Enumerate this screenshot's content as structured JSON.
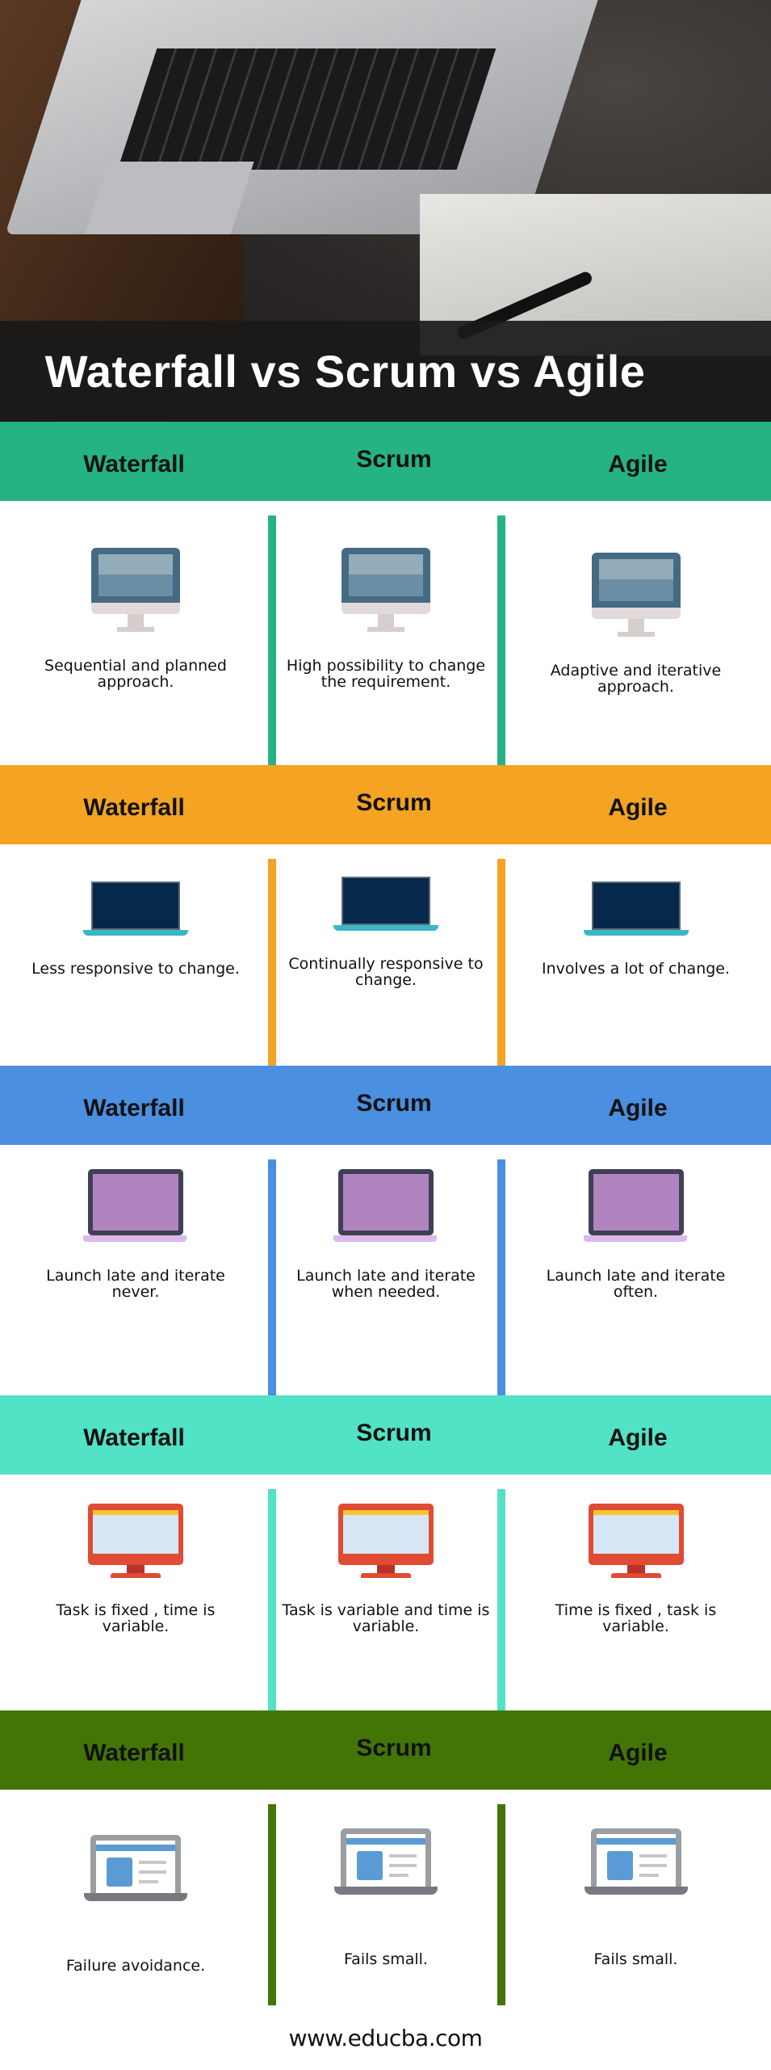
{
  "title": "Waterfall vs Scrum vs Agile",
  "footer": "www.educba.com",
  "sections": [
    {
      "color": "#25b386",
      "icon": "desktop-monitor-icon",
      "headers": [
        "Waterfall",
        "Scrum",
        "Agile"
      ],
      "items": [
        "Sequential and planned approach.",
        "High possibility to change the requirement.",
        "Adaptive and iterative approach."
      ]
    },
    {
      "color": "#f4a322",
      "icon": "laptop-icon",
      "headers": [
        "Waterfall",
        "Scrum",
        "Agile"
      ],
      "items": [
        "Less responsive to change.",
        "Continually responsive to change.",
        "Involves a lot of change."
      ]
    },
    {
      "color": "#4a8fe0",
      "icon": "laptop-icon",
      "headers": [
        "Waterfall",
        "Scrum",
        "Agile"
      ],
      "items": [
        "Launch late and iterate never.",
        "Launch late and iterate when needed.",
        "Launch late and iterate often."
      ]
    },
    {
      "color": "#52e2c5",
      "icon": "desktop-monitor-icon",
      "headers": [
        "Waterfall",
        "Scrum",
        "Agile"
      ],
      "items": [
        "Task is fixed , time is variable.",
        "Task is variable and time is variable.",
        "Time is fixed , task is variable."
      ]
    },
    {
      "color": "#437506",
      "icon": "laptop-webpage-icon",
      "headers": [
        "Waterfall",
        "Scrum",
        "Agile"
      ],
      "items": [
        "Failure avoidance.",
        "Fails small.",
        "Fails small."
      ]
    }
  ]
}
